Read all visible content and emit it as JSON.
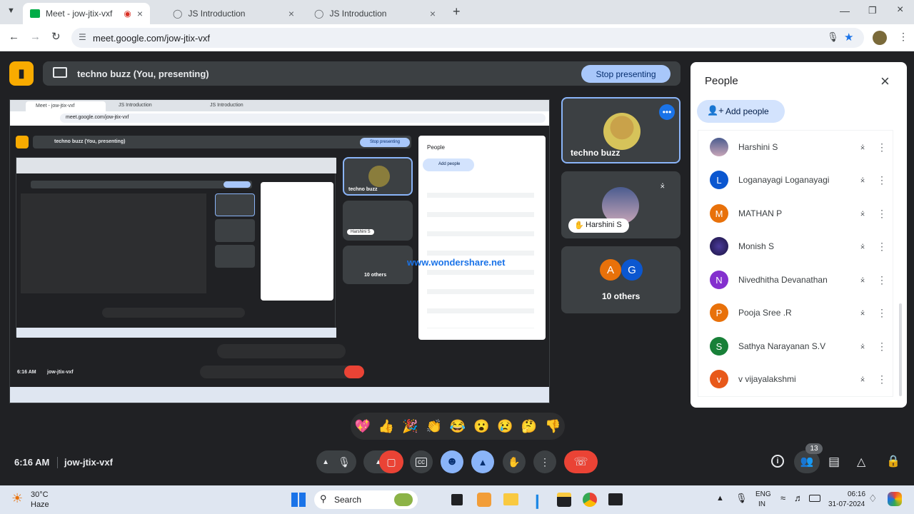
{
  "browser": {
    "tabs": [
      {
        "label": "Meet - jow-jtix-vxf",
        "active": true
      },
      {
        "label": "JS Introduction",
        "active": false
      },
      {
        "label": "JS Introduction",
        "active": false
      }
    ],
    "new_tab": "+",
    "url": "meet.google.com/jow-jtix-vxf"
  },
  "meet": {
    "presenting_label": "techno buzz (You, presenting)",
    "stop_presenting": "Stop presenting",
    "tiles": {
      "self_name": "techno buzz",
      "harshini": "Harshini S",
      "others_label": "10 others",
      "others_initials": [
        "A",
        "G"
      ]
    },
    "watermark": "www.wondershare.net",
    "time": "6:16 AM",
    "meeting_code": "jow-jtix-vxf",
    "reactions": [
      "💖",
      "👍",
      "🎉",
      "👏",
      "😂",
      "😮",
      "😢",
      "🤔",
      "👎"
    ],
    "participant_count": "13"
  },
  "people_panel": {
    "title": "People",
    "add_people": "Add people",
    "participants": [
      {
        "name": "Harshini S",
        "initial": "",
        "color": "#5b6aa8"
      },
      {
        "name": "Loganayagi Loganayagi",
        "initial": "L",
        "color": "#0b57d0"
      },
      {
        "name": "MATHAN P",
        "initial": "M",
        "color": "#e8710a"
      },
      {
        "name": "Monish S",
        "initial": "",
        "color": "#2a1f5c"
      },
      {
        "name": "Nivedhitha Devanathan",
        "initial": "N",
        "color": "#8430ce"
      },
      {
        "name": "Pooja Sree .R",
        "initial": "P",
        "color": "#e8710a"
      },
      {
        "name": "Sathya Narayanan S.V",
        "initial": "S",
        "color": "#188038"
      },
      {
        "name": "v vijayalakshmi",
        "initial": "v",
        "color": "#e8591a"
      }
    ]
  },
  "shared_screen": {
    "tabs": [
      "Meet - jow-jtix-vxf",
      "JS Introduction",
      "JS Introduction"
    ],
    "url": "meet.google.com/jow-jtix-vxf",
    "presenting_label": "techno buzz (You, presenting)",
    "stop_presenting": "Stop presenting",
    "panel_title": "People",
    "add_people": "Add people",
    "self_name": "techno buzz",
    "harshini": "Harshini S",
    "others_label": "10 others",
    "time": "6:16 AM",
    "meeting_code": "jow-jtix-vxf"
  },
  "taskbar": {
    "weather_temp": "30°C",
    "weather_desc": "Haze",
    "search": "Search",
    "lang_top": "ENG",
    "lang_bottom": "IN",
    "clock_time": "06:16",
    "clock_date": "31-07-2024"
  }
}
